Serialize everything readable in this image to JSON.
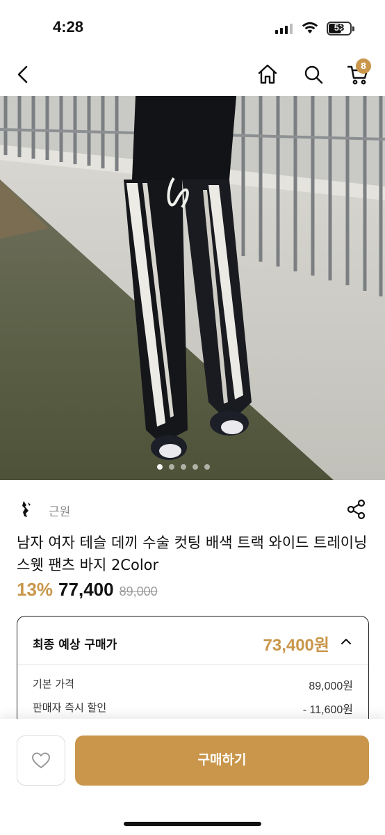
{
  "status": {
    "time": "4:28",
    "battery": "53"
  },
  "nav": {
    "cart_count": "8",
    "icons": [
      "chevron-left-icon",
      "home-icon",
      "search-icon",
      "cart-icon"
    ]
  },
  "gallery": {
    "dot_count": 5,
    "active_index": 0
  },
  "seller": {
    "name": "근원"
  },
  "product": {
    "title": "남자 여자 테슬 데끼 수술 컷팅 배색 트랙 와이드 트레이닝 스웻 팬츠 바지 2Color",
    "discount": "13%",
    "sale_price": "77,400",
    "original_price": "89,000"
  },
  "final_price": {
    "label": "최종 예상 구매가",
    "value": "73,400원",
    "rows": [
      {
        "label": "기본 가격",
        "value": "89,000원"
      },
      {
        "label": "판매자 즉시 할인",
        "value": "- 11,600원"
      }
    ]
  },
  "bottom": {
    "buy_label": "구매하기"
  },
  "colors": {
    "accent": "#c9964b",
    "text": "#111111",
    "muted": "#8a8a8a"
  }
}
